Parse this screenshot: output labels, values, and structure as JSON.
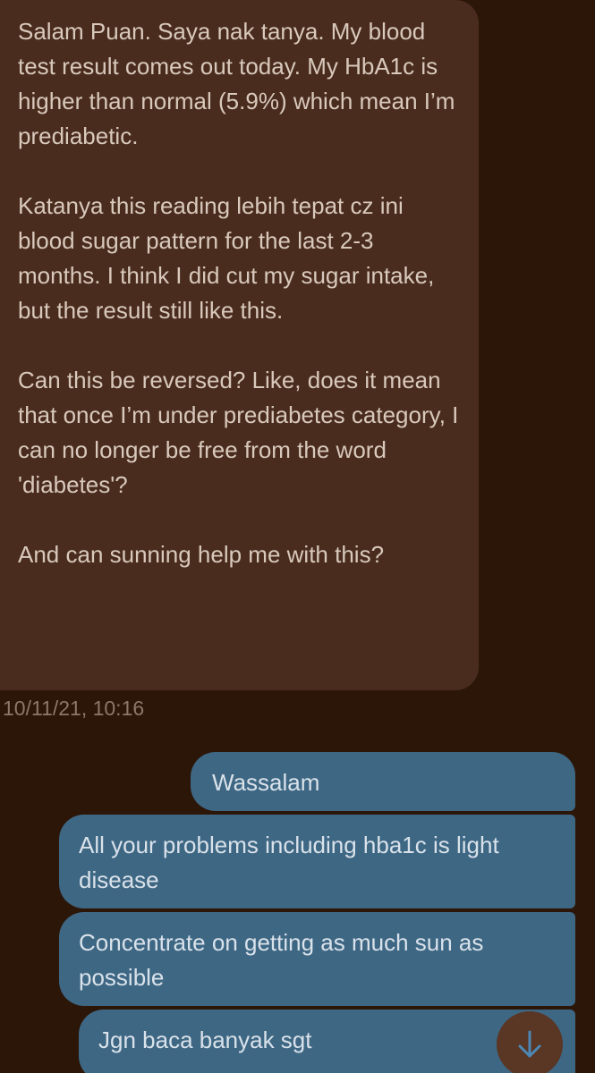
{
  "incoming_message": {
    "paragraphs": [
      "Salam Puan. Saya nak tanya. My blood test result comes out today. My HbA1c is higher than normal (5.9%) which mean I’m prediabetic.",
      "Katanya this reading lebih tepat cz ini blood sugar pattern for the last 2-3 months. I think I did cut my sugar intake, but the result still like this.",
      "Can this be reversed? Like, does it mean that once I’m under prediabetes category, I can no longer be free from the word 'diabetes'?",
      "And can sunning help me with this?"
    ],
    "timestamp": "10/11/21, 10:16"
  },
  "outgoing_messages": [
    "Wassalam",
    "All your problems including hba1c is light disease",
    "Concentrate on getting as much sun as possible",
    "Jgn baca banyak sgt"
  ],
  "colors": {
    "background": "#2c1608",
    "incoming_bubble": "#4a2c1e",
    "outgoing_bubble": "#3e6784",
    "scroll_button": "#5a3624"
  },
  "icons": {
    "scroll_down": "arrow-down-icon"
  }
}
